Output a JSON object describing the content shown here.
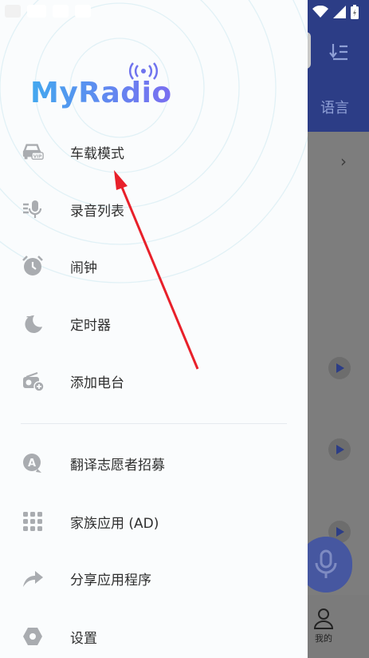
{
  "app": {
    "logo_text": "MyRadio"
  },
  "background": {
    "language_label": "语言",
    "mine_label": "我的"
  },
  "drawer": {
    "items": [
      {
        "label": "车载模式",
        "icon": "car-vip-icon"
      },
      {
        "label": "录音列表",
        "icon": "mic-list-icon"
      },
      {
        "label": "闹钟",
        "icon": "alarm-clock-icon"
      },
      {
        "label": "定时器",
        "icon": "sleep-timer-icon"
      },
      {
        "label": "添加电台",
        "icon": "add-radio-icon"
      }
    ],
    "items2": [
      {
        "label": "翻译志愿者招募",
        "icon": "translate-icon"
      },
      {
        "label": "家族应用 (AD)",
        "icon": "apps-grid-icon"
      },
      {
        "label": "分享应用程序",
        "icon": "share-icon"
      },
      {
        "label": "设置",
        "icon": "settings-icon"
      }
    ]
  },
  "colors": {
    "header": "#2c3d86",
    "accent": "#4657a0",
    "icon_gray": "#a9acb0",
    "arrow": "#e8202a"
  }
}
